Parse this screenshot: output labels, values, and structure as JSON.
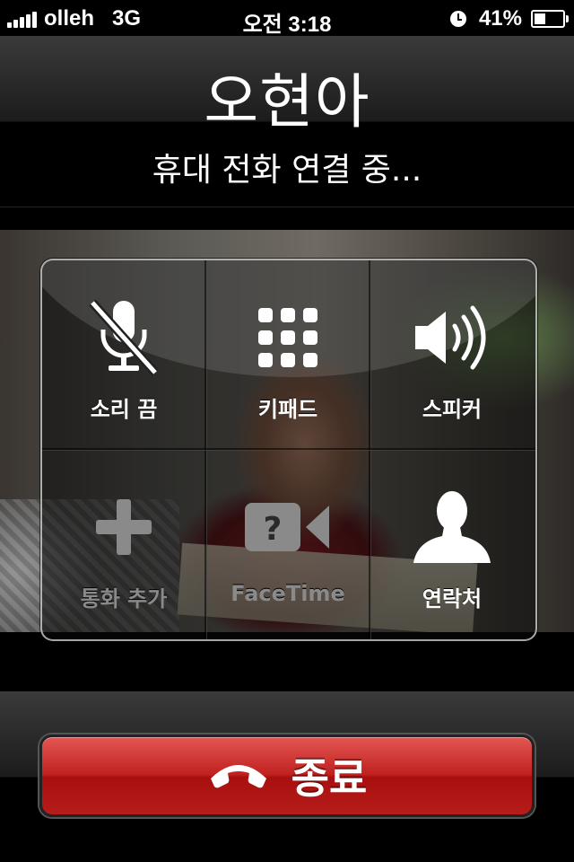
{
  "status_bar": {
    "carrier": "olleh",
    "network": "3G",
    "time": "오전 3:18",
    "battery_text": "41%",
    "battery_level": 0.41
  },
  "call": {
    "caller_name": "오현아",
    "status": "휴대 전화 연결 중..."
  },
  "controls": {
    "mute": {
      "label": "소리 끔",
      "icon": "microphone-muted-icon"
    },
    "keypad": {
      "label": "키패드",
      "icon": "keypad-icon"
    },
    "speaker": {
      "label": "스피커",
      "icon": "speaker-icon"
    },
    "add_call": {
      "label": "통화 추가",
      "icon": "plus-icon"
    },
    "facetime": {
      "label": "FaceTime",
      "icon": "facetime-camera-icon"
    },
    "contacts": {
      "label": "연락처",
      "icon": "person-icon"
    }
  },
  "end_call": {
    "label": "종료",
    "icon": "hang-up-phone-icon",
    "color": "#c02220"
  }
}
